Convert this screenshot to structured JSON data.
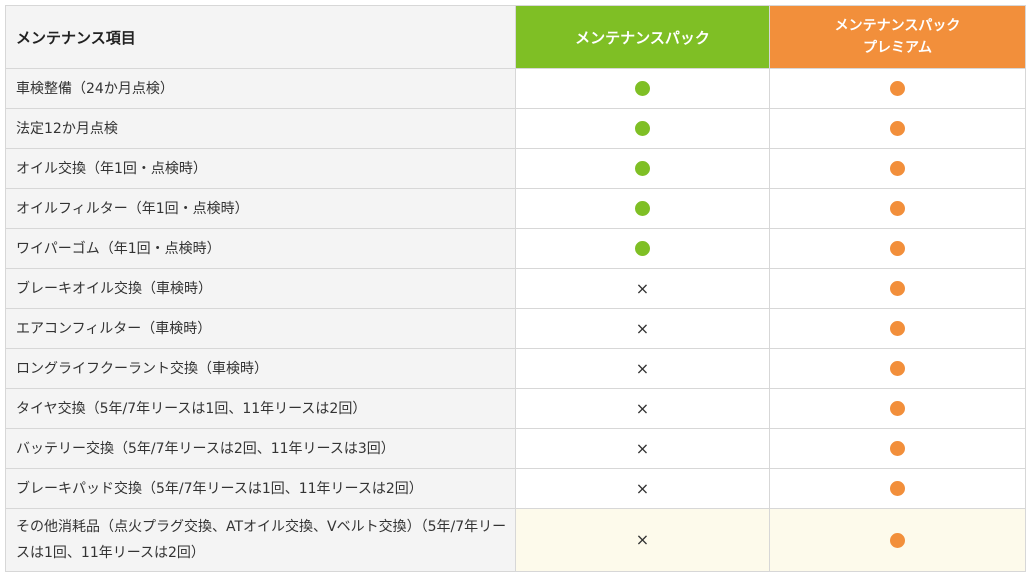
{
  "colors": {
    "standard": "#7fbf25",
    "premium": "#f28f3b"
  },
  "header": {
    "item": "メンテナンス項目",
    "standard": "メンテナンスパック",
    "premium_line1": "メンテナンスパック",
    "premium_line2": "プレミアム"
  },
  "rows": [
    {
      "item": "車検整備（24か月点検）",
      "standard": "included",
      "premium": "included"
    },
    {
      "item": "法定12か月点検",
      "standard": "included",
      "premium": "included"
    },
    {
      "item": "オイル交換（年1回・点検時）",
      "standard": "included",
      "premium": "included"
    },
    {
      "item": "オイルフィルター（年1回・点検時）",
      "standard": "included",
      "premium": "included"
    },
    {
      "item": "ワイパーゴム（年1回・点検時）",
      "standard": "included",
      "premium": "included"
    },
    {
      "item": "ブレーキオイル交換（車検時）",
      "standard": "×",
      "premium": "included"
    },
    {
      "item": "エアコンフィルター（車検時）",
      "standard": "×",
      "premium": "included"
    },
    {
      "item": "ロングライフクーラント交換（車検時）",
      "standard": "×",
      "premium": "included"
    },
    {
      "item": "タイヤ交換（5年/7年リースは1回、11年リースは2回）",
      "standard": "×",
      "premium": "included"
    },
    {
      "item": "バッテリー交換（5年/7年リースは2回、11年リースは3回）",
      "standard": "×",
      "premium": "included"
    },
    {
      "item": "ブレーキパッド交換（5年/7年リースは1回、11年リースは2回）",
      "standard": "×",
      "premium": "included"
    },
    {
      "item": "その他消耗品（点火プラグ交換、ATオイル交換、Vベルト交換）（5年/7年リースは1回、11年リースは2回）",
      "standard": "×",
      "premium": "included"
    }
  ]
}
